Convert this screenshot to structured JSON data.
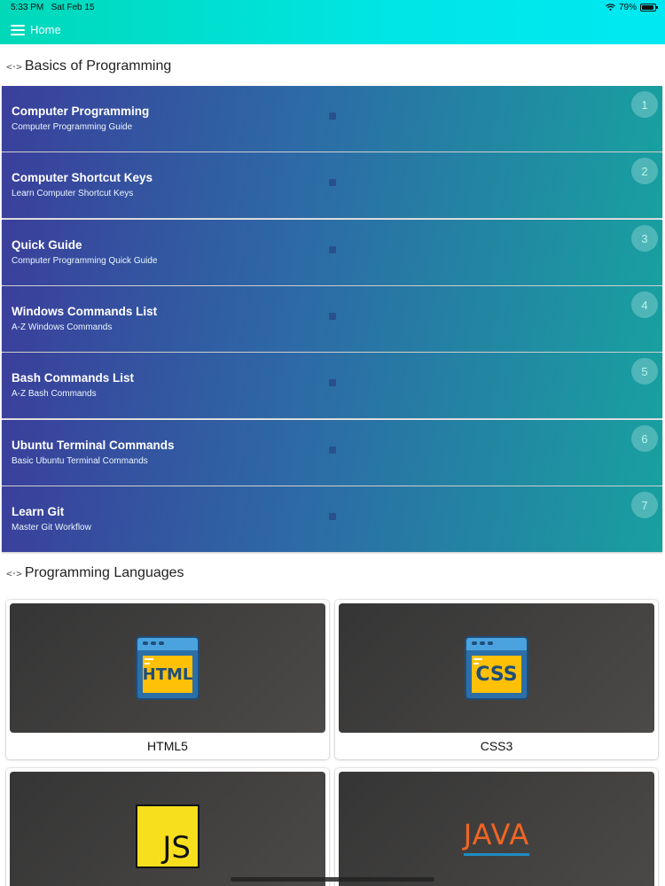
{
  "status": {
    "time": "5:33 PM",
    "date": "Sat Feb 15",
    "battery": "79%"
  },
  "nav": {
    "title": "Home"
  },
  "sections": {
    "basics": "Basics of Programming",
    "languages": "Programming Languages"
  },
  "topics": [
    {
      "title": "Computer Programming",
      "subtitle": "Computer Programming Guide",
      "num": "1"
    },
    {
      "title": "Computer Shortcut Keys",
      "subtitle": "Learn Computer Shortcut Keys",
      "num": "2"
    },
    {
      "title": "Quick Guide",
      "subtitle": "Computer Programming Quick Guide",
      "num": "3"
    },
    {
      "title": "Windows Commands List",
      "subtitle": "A-Z Windows Commands",
      "num": "4"
    },
    {
      "title": "Bash Commands List",
      "subtitle": "A-Z Bash Commands",
      "num": "5"
    },
    {
      "title": "Ubuntu Terminal Commands",
      "subtitle": "Basic Ubuntu Terminal Commands",
      "num": "6"
    },
    {
      "title": "Learn Git",
      "subtitle": "Master Git Workflow",
      "num": "7"
    }
  ],
  "languages": [
    {
      "label": "HTML5",
      "logo_text": "HTML"
    },
    {
      "label": "CSS3",
      "logo_text": "CSS"
    },
    {
      "label": "",
      "logo_text": "JS"
    },
    {
      "label": "",
      "logo_text": "JAVA"
    }
  ],
  "colors": {
    "header": "#00e0d0",
    "card_start": "#3a3f9b",
    "card_end": "#18a0a0"
  }
}
